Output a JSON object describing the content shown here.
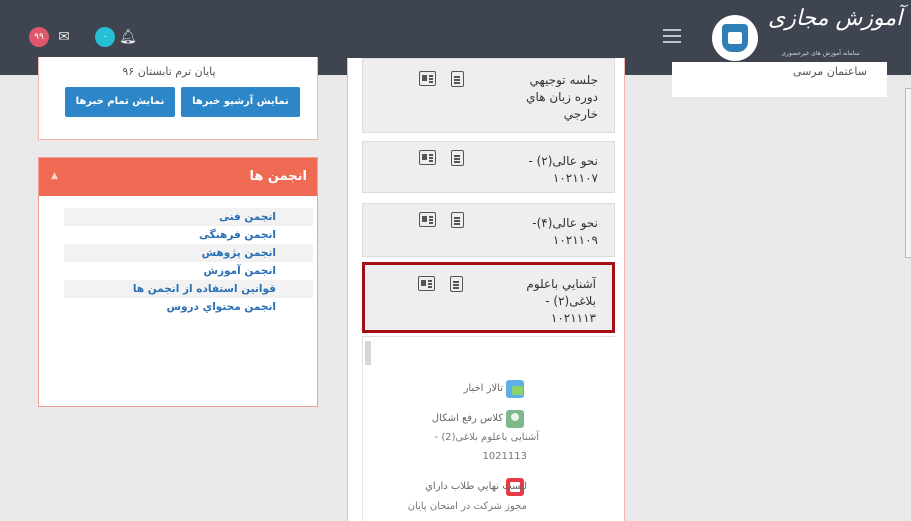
{
  "navbar": {
    "messages_badge": "۹۹",
    "notifications_badge": "۰",
    "brand_title": "آموزش مجازی",
    "brand_subtitle": "سامانه آموزش های غیرحضوری"
  },
  "news": {
    "term_text": "پایان ترم تابستان ۹۶",
    "archive_button": "نمایش آرشیو خبرها",
    "all_button": "نمایش تمام خبرها"
  },
  "groups": {
    "title": "انجمن ها",
    "items": [
      {
        "label": "انجمن فنی"
      },
      {
        "label": "انجمن فرهنگی"
      },
      {
        "label": "انجمن پژوهش"
      },
      {
        "label": "انجمن آموزش"
      },
      {
        "label": "قوانین استفاده از انجمن ها"
      },
      {
        "label": "انجمن محتواي دروس"
      }
    ]
  },
  "courses": [
    {
      "line1": "جلسه توجيهي",
      "line2": "دوره زبان هاي",
      "line3": "خارجي"
    },
    {
      "line1": "نحو عالی(۲) -",
      "line2": "۱۰۲۱۱۰۷"
    },
    {
      "line1": "نحو عالی(۴)-",
      "line2": "۱۰۲۱۱۰۹"
    },
    {
      "line1": "آشنايي باعلوم",
      "line2": "بلاغی(۲) -",
      "line3": "۱۰۲۱۱۱۳"
    }
  ],
  "activities": {
    "forum": "تالار اخبار",
    "class_title": "کلاس رفع اشکال",
    "class_course": "آشنایی باعلوم بلاغی(2) -",
    "class_code": "1021113",
    "list_title": "ليست نهايي طلاب داراي",
    "list_line2": "مجوز شركت در امتحان پايان"
  },
  "right_panel": {
    "text": "ساعتمان مرسی"
  },
  "colors": {
    "navbar": "#3f4451",
    "accent_orange": "#ee6a52",
    "button_blue": "#2d86c8",
    "selected_border": "#a40f16",
    "link_blue": "#2a6fb3"
  }
}
